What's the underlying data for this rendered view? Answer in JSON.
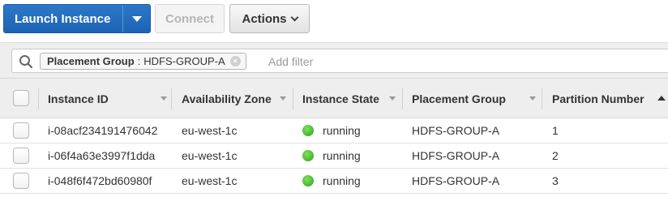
{
  "toolbar": {
    "launch_label": "Launch Instance",
    "connect_label": "Connect",
    "actions_label": "Actions"
  },
  "filter": {
    "token_key": "Placement Group",
    "token_sep": ":",
    "token_value": "HDFS-GROUP-A",
    "token_remove": "×",
    "placeholder": "Add filter"
  },
  "table": {
    "columns": [
      "Instance ID",
      "Availability Zone",
      "Instance State",
      "Placement Group",
      "Partition Number"
    ],
    "sorted_column": "Partition Number",
    "sort_direction": "ascending",
    "rows": [
      {
        "instance_id": "i-08acf234191476042",
        "zone": "eu-west-1c",
        "state": "running",
        "group": "HDFS-GROUP-A",
        "partition": "1"
      },
      {
        "instance_id": "i-06f4a63e3997f1dda",
        "zone": "eu-west-1c",
        "state": "running",
        "group": "HDFS-GROUP-A",
        "partition": "2"
      },
      {
        "instance_id": "i-048f6f472bd60980f",
        "zone": "eu-west-1c",
        "state": "running",
        "group": "HDFS-GROUP-A",
        "partition": "3"
      }
    ]
  },
  "colors": {
    "primary": "#1d63b4",
    "running": "#2fa31a"
  },
  "icons": {
    "search": "search-icon",
    "launch_dropdown": "caret-down-icon",
    "actions_dropdown": "chevron-down-icon",
    "token_remove": "close-icon",
    "status": "running-status-icon"
  }
}
